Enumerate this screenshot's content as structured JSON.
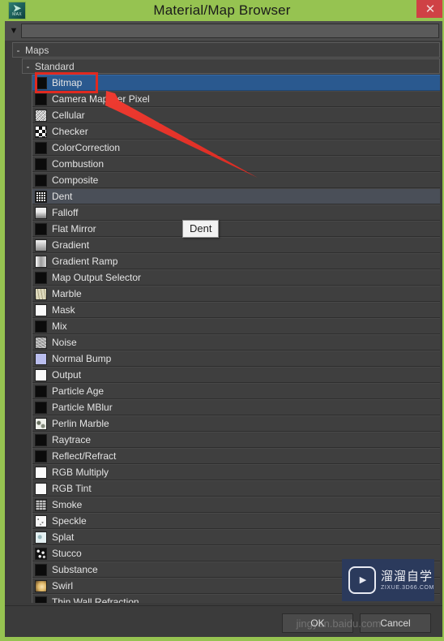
{
  "window": {
    "title": "Material/Map Browser",
    "icon_glyph": "➤",
    "icon_sub": "MAX",
    "close_label": "✕"
  },
  "filterbar": {
    "dropdown_icon": "▼",
    "search_value": "",
    "search_placeholder": ""
  },
  "tree": {
    "groups": [
      {
        "expander": "-",
        "label": "Maps"
      },
      {
        "expander": "-",
        "label": "Standard"
      }
    ],
    "items": [
      {
        "label": "Bitmap",
        "swatch": "sw-black",
        "state": "selected"
      },
      {
        "label": "Camera Map Per Pixel",
        "swatch": "sw-black",
        "state": "normal"
      },
      {
        "label": "Cellular",
        "swatch": "sw-noise",
        "state": "normal"
      },
      {
        "label": "Checker",
        "swatch": "sw-checker",
        "state": "normal"
      },
      {
        "label": "ColorCorrection",
        "swatch": "sw-black",
        "state": "normal"
      },
      {
        "label": "Combustion",
        "swatch": "sw-black",
        "state": "normal"
      },
      {
        "label": "Composite",
        "swatch": "sw-black",
        "state": "normal"
      },
      {
        "label": "Dent",
        "swatch": "sw-dent",
        "state": "hovered"
      },
      {
        "label": "Falloff",
        "swatch": "sw-fallofff",
        "state": "normal"
      },
      {
        "label": "Flat Mirror",
        "swatch": "sw-black",
        "state": "normal"
      },
      {
        "label": "Gradient",
        "swatch": "sw-grad-wk",
        "state": "normal"
      },
      {
        "label": "Gradient Ramp",
        "swatch": "sw-grad-ramp",
        "state": "normal"
      },
      {
        "label": "Map Output Selector",
        "swatch": "sw-black",
        "state": "normal"
      },
      {
        "label": "Marble",
        "swatch": "sw-marble",
        "state": "normal"
      },
      {
        "label": "Mask",
        "swatch": "sw-white",
        "state": "normal"
      },
      {
        "label": "Mix",
        "swatch": "sw-black",
        "state": "normal"
      },
      {
        "label": "Noise",
        "swatch": "sw-greynoise",
        "state": "normal"
      },
      {
        "label": "Normal Bump",
        "swatch": "sw-lavender",
        "state": "normal"
      },
      {
        "label": "Output",
        "swatch": "sw-white",
        "state": "normal"
      },
      {
        "label": "Particle Age",
        "swatch": "sw-black",
        "state": "normal"
      },
      {
        "label": "Particle MBlur",
        "swatch": "sw-black",
        "state": "normal"
      },
      {
        "label": "Perlin Marble",
        "swatch": "sw-perlin",
        "state": "normal"
      },
      {
        "label": "Raytrace",
        "swatch": "sw-black",
        "state": "normal"
      },
      {
        "label": "Reflect/Refract",
        "swatch": "sw-black",
        "state": "normal"
      },
      {
        "label": "RGB Multiply",
        "swatch": "sw-white",
        "state": "normal"
      },
      {
        "label": "RGB Tint",
        "swatch": "sw-white",
        "state": "normal"
      },
      {
        "label": "Smoke",
        "swatch": "sw-smoke",
        "state": "normal"
      },
      {
        "label": "Speckle",
        "swatch": "sw-speckle",
        "state": "normal"
      },
      {
        "label": "Splat",
        "swatch": "sw-splat",
        "state": "normal"
      },
      {
        "label": "Stucco",
        "swatch": "sw-stucco",
        "state": "normal"
      },
      {
        "label": "Substance",
        "swatch": "sw-black",
        "state": "normal"
      },
      {
        "label": "Swirl",
        "swatch": "sw-swirl",
        "state": "normal"
      },
      {
        "label": "Thin Wall Refraction",
        "swatch": "sw-black",
        "state": "normal"
      }
    ]
  },
  "tooltip": {
    "text": "Dent"
  },
  "annotation": {
    "highlight_color": "#e02a20",
    "arrow_color": "#e8332a"
  },
  "footer": {
    "ok_label": "OK",
    "cancel_label": "Cancel",
    "source_watermark": "jingyan.baidu.com"
  },
  "watermark": {
    "brand_cn": "溜溜自学",
    "brand_url": "ZIXUE.3D66.COM",
    "play_glyph": "▶"
  },
  "colors": {
    "window_frame": "#96c351",
    "panel_bg": "#3c3c3c",
    "row_bg": "#3f3f3f",
    "selected_row": "#2a598f",
    "hover_row": "#4a4f58",
    "text": "#e4e4e4",
    "close_btn": "#cf4145",
    "watermark_bg": "#2b3a5c"
  }
}
